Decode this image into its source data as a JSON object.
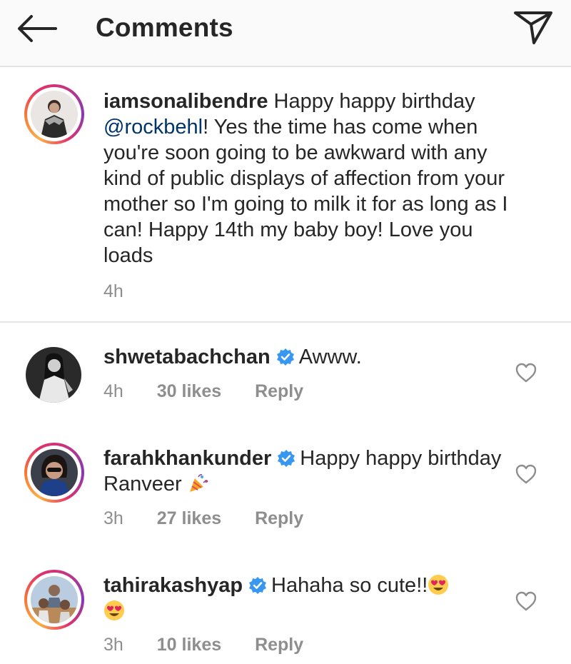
{
  "header": {
    "title": "Comments"
  },
  "caption": {
    "username": "iamsonalibendre",
    "text_1": " Happy happy birthday",
    "mention": "@rockbehl",
    "text_2": "! Yes the time has come when you're soon going to be awkward with any kind of public displays of affection from your mother so I'm going to milk it for as long as I can! Happy 14th my baby boy! Love you loads",
    "time": "4h"
  },
  "comments": [
    {
      "username": "shwetabachchan",
      "text": "Awww.",
      "time": "4h",
      "likes": "30 likes",
      "reply": "Reply"
    },
    {
      "username": "farahkhankunder",
      "text": "Happy happy birthday Ranveer",
      "time": "3h",
      "likes": "27 likes",
      "reply": "Reply"
    },
    {
      "username": "tahirakashyap",
      "text": "Hahaha so cute!!",
      "time": "3h",
      "likes": "10 likes",
      "reply": "Reply"
    }
  ],
  "icons": {
    "back": "back-arrow-icon",
    "send": "send-icon",
    "verified": "verified-badge-icon",
    "heart": "heart-outline-icon"
  },
  "colors": {
    "verified": "#3897f0",
    "mention": "#003569",
    "meta": "#8e8e8e"
  }
}
